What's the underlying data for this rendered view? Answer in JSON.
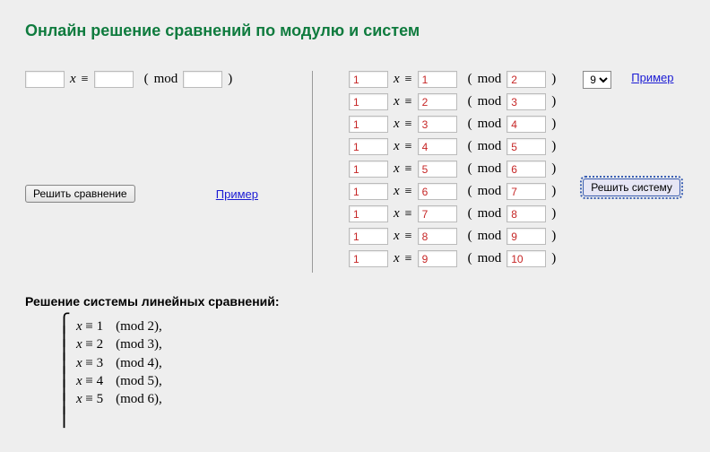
{
  "title": "Онлайн решение сравнений по модулю и систем",
  "single": {
    "a": "",
    "b": "",
    "m": "",
    "x_label": "x",
    "equiv": "≡",
    "lparen": "(",
    "rparen": ")",
    "mod": "mod",
    "solve_button": "Решить сравнение",
    "example_link": "Пример"
  },
  "system": {
    "x_label": "x",
    "equiv": "≡",
    "lparen": "(",
    "rparen": ")",
    "mod": "mod",
    "rows": [
      {
        "a": "1",
        "b": "1",
        "m": "2"
      },
      {
        "a": "1",
        "b": "2",
        "m": "3"
      },
      {
        "a": "1",
        "b": "3",
        "m": "4"
      },
      {
        "a": "1",
        "b": "4",
        "m": "5"
      },
      {
        "a": "1",
        "b": "5",
        "m": "6"
      },
      {
        "a": "1",
        "b": "6",
        "m": "7"
      },
      {
        "a": "1",
        "b": "7",
        "m": "8"
      },
      {
        "a": "1",
        "b": "8",
        "m": "9"
      },
      {
        "a": "1",
        "b": "9",
        "m": "10"
      }
    ],
    "count_select": "9",
    "example_link": "Пример",
    "solve_button": "Решить систему"
  },
  "solution": {
    "title": "Решение системы линейных сравнений:",
    "lines": [
      {
        "lhs": "x ≡ 1",
        "rhs": "(mod 2),"
      },
      {
        "lhs": "x ≡ 2",
        "rhs": "(mod 3),"
      },
      {
        "lhs": "x ≡ 3",
        "rhs": "(mod 4),"
      },
      {
        "lhs": "x ≡ 4",
        "rhs": "(mod 5),"
      },
      {
        "lhs": "x ≡ 5",
        "rhs": "(mod 6),"
      }
    ]
  }
}
